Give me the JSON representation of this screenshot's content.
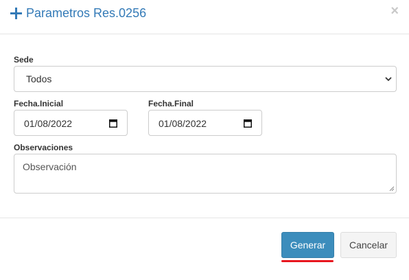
{
  "header": {
    "title": "Parametros Res.0256",
    "close_label": "×"
  },
  "form": {
    "sede": {
      "label": "Sede",
      "selected": "Todos"
    },
    "fecha_inicial": {
      "label": "Fecha.Inicial",
      "value": "01/08/2022"
    },
    "fecha_final": {
      "label": "Fecha.Final",
      "value": "01/08/2022"
    },
    "observaciones": {
      "label": "Observaciones",
      "placeholder": "Observación"
    }
  },
  "footer": {
    "generate_label": "Generar",
    "cancel_label": "Cancelar"
  },
  "colors": {
    "accent": "#337ab7",
    "primary_button": "#3c8dbc",
    "annotation_underline": "#e8161e"
  },
  "icons": [
    "plus-icon",
    "close-icon",
    "chevron-down-icon",
    "calendar-icon",
    "resize-handle-icon"
  ]
}
